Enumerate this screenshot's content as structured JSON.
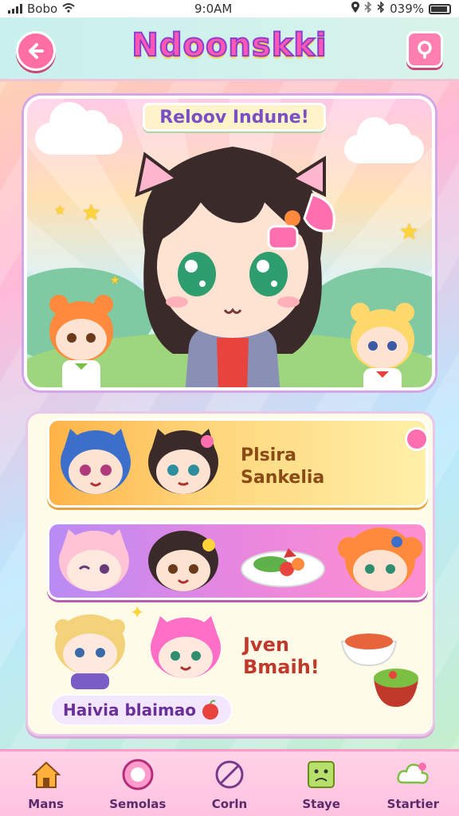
{
  "status_bar": {
    "carrier": "Bobo",
    "time": "9:0AM",
    "battery": "039%"
  },
  "header": {
    "title": "Ndoonskki",
    "back_icon": "back-arrow-icon",
    "search_icon": "search-icon"
  },
  "hero": {
    "banner": "Reloov Indune!"
  },
  "list": {
    "row1_line1": "Plsira",
    "row1_line2": "Sankelia",
    "row3_line1": "Jven",
    "row3_line2": "Bmaih!",
    "badge_text": "Haivia blaimao"
  },
  "bottom_nav": {
    "items": [
      {
        "label": "Mans",
        "icon": "house-icon"
      },
      {
        "label": "Semolas",
        "icon": "circle-icon"
      },
      {
        "label": "Corln",
        "icon": "no-sign-icon"
      },
      {
        "label": "Staye",
        "icon": "sad-face-icon"
      },
      {
        "label": "Startier",
        "icon": "cloud-icon"
      }
    ]
  },
  "colors": {
    "accent": "#ff57b4",
    "title_outline": "#8a3fd0",
    "nav_bg": "#ffc2df"
  }
}
